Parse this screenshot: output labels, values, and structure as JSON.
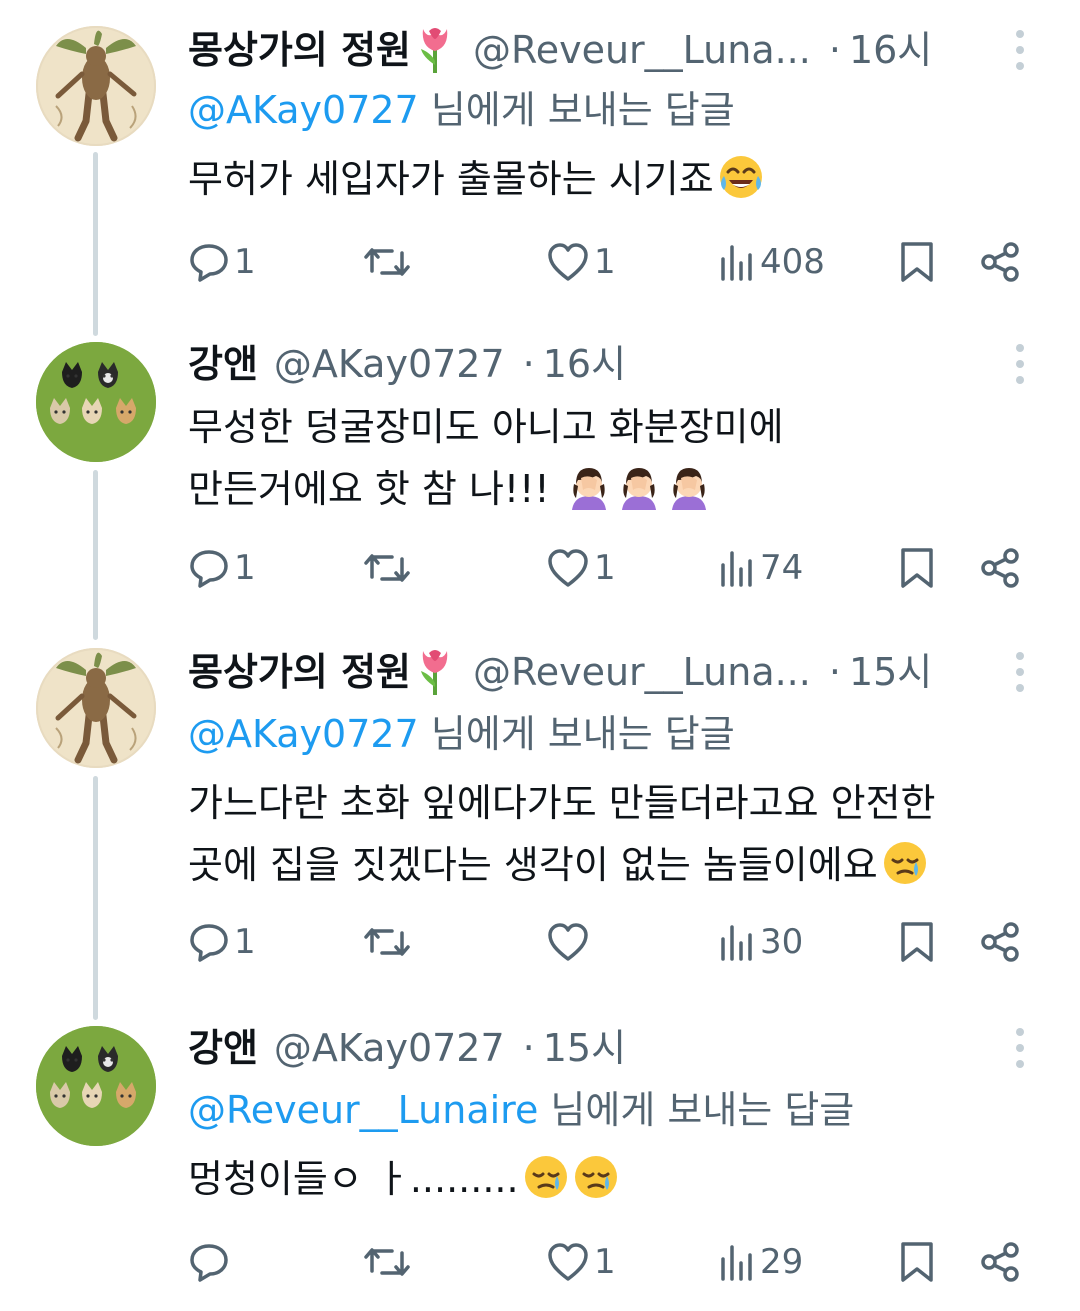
{
  "colors": {
    "link": "#1d9bf0",
    "secondary": "#536471",
    "primary": "#0f1419",
    "thread_line": "#cfd9de"
  },
  "tweets": [
    {
      "name": "몽상가의 정원",
      "name_emoji": "tulip",
      "handle": "@Reveur__Luna...",
      "dot": "·",
      "time": "16시",
      "reply_mention": "@AKay0727",
      "reply_suffix": " 님에게 보내는 답글",
      "text_lines": [
        "무허가 세입자가 출몰하는 시기죠"
      ],
      "text_emojis": [
        "face-with-tears-of-joy"
      ],
      "replies": "1",
      "retweets": "",
      "likes": "1",
      "views": "408"
    },
    {
      "name": "강앤",
      "handle": "@AKay0727",
      "dot": "·",
      "time": "16시",
      "text_lines": [
        "무성한 덩굴장미도 아니고 화분장미에",
        "만든거에요 핫 참 나!!! "
      ],
      "text_emojis": [
        "woman-facepalming",
        "woman-facepalming",
        "woman-facepalming"
      ],
      "replies": "1",
      "retweets": "",
      "likes": "1",
      "views": "74"
    },
    {
      "name": "몽상가의 정원",
      "name_emoji": "tulip",
      "handle": "@Reveur__Luna...",
      "dot": "·",
      "time": "15시",
      "reply_mention": "@AKay0727",
      "reply_suffix": " 님에게 보내는 답글",
      "text_lines": [
        "가느다란 초화 잎에다가도 만들더라고요 안전한",
        "곳에 집을 짓겠다는 생각이 없는 놈들이에요"
      ],
      "text_emojis": [
        "face-holding-back-tears"
      ],
      "replies": "1",
      "retweets": "",
      "likes": "",
      "views": "30"
    },
    {
      "name": "강앤",
      "handle": "@AKay0727",
      "dot": "·",
      "time": "15시",
      "reply_mention": "@Reveur__Lunaire",
      "reply_suffix": " 님에게 보내는 답글",
      "text_lines": [
        "멍청이들ㅇ ㅏ........."
      ],
      "text_emojis": [
        "face-holding-back-tears",
        "face-holding-back-tears"
      ],
      "replies": "",
      "retweets": "",
      "likes": "1",
      "views": "29"
    }
  ]
}
